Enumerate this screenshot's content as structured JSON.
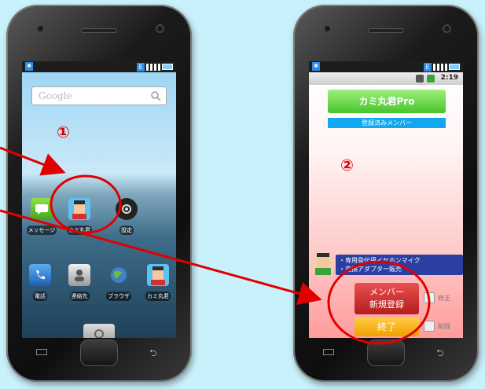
{
  "phone1": {
    "search": {
      "placeholder": "Google"
    },
    "marker": "①",
    "home_icons_row1": [
      {
        "label": "メッセージ",
        "icon": "message-icon"
      },
      {
        "label": "カミ丸君",
        "icon": "kamimaru-app-icon"
      },
      {
        "label": "設定",
        "icon": "settings-icon"
      }
    ],
    "home_icons_row2": [
      {
        "label": "電話",
        "icon": "phone-icon"
      },
      {
        "label": "連絡先",
        "icon": "contacts-icon"
      },
      {
        "label": "ブラウザ",
        "icon": "browser-icon"
      },
      {
        "label": "カミ丸君",
        "icon": "kamimaru-app-icon"
      }
    ]
  },
  "phone2": {
    "time": "2:19",
    "title_button": "カミ丸君Pro",
    "subheader": "登録済みメンバー",
    "marker": "②",
    "member_info": [
      "・専用骨伝導イヤホンマイク",
      "・変換アダプター販売"
    ],
    "new_member_button": [
      "メンバー",
      "新規登録"
    ],
    "end_button": "終了",
    "edit_label": "修正",
    "delete_label": "削除"
  },
  "colors": {
    "annotation": "#e00000",
    "title_button": "#48c42c",
    "banner": "#11a8f0",
    "new_button": "#d03232",
    "end_button": "#f5b000"
  }
}
